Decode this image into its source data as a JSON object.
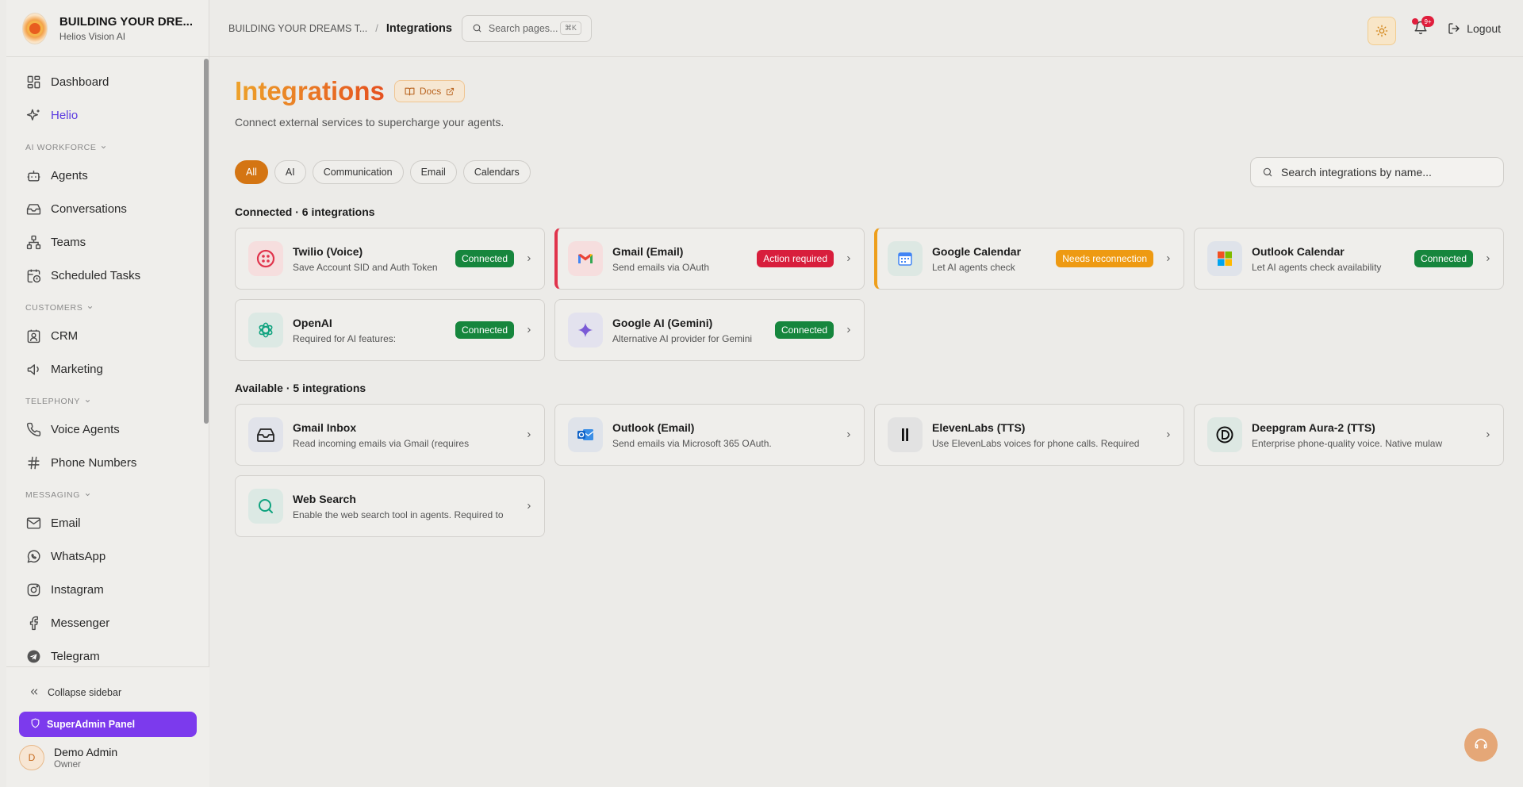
{
  "brand": {
    "title": "BUILDING YOUR DRE...",
    "subtitle": "Helios Vision AI"
  },
  "sidebar": {
    "top": [
      {
        "label": "Dashboard",
        "icon": "dashboard-icon"
      },
      {
        "label": "Helio",
        "icon": "sparkles-icon",
        "active": true
      }
    ],
    "sections": [
      {
        "title": "AI WORKFORCE",
        "items": [
          {
            "label": "Agents",
            "icon": "robot-icon"
          },
          {
            "label": "Conversations",
            "icon": "inbox-icon"
          },
          {
            "label": "Teams",
            "icon": "org-chart-icon"
          },
          {
            "label": "Scheduled Tasks",
            "icon": "calendar-clock-icon"
          }
        ]
      },
      {
        "title": "CUSTOMERS",
        "items": [
          {
            "label": "CRM",
            "icon": "contact-card-icon"
          },
          {
            "label": "Marketing",
            "icon": "megaphone-icon"
          }
        ]
      },
      {
        "title": "TELEPHONY",
        "items": [
          {
            "label": "Voice Agents",
            "icon": "phone-icon"
          },
          {
            "label": "Phone Numbers",
            "icon": "hash-icon"
          }
        ]
      },
      {
        "title": "MESSAGING",
        "items": [
          {
            "label": "Email",
            "icon": "mail-icon"
          },
          {
            "label": "WhatsApp",
            "icon": "whatsapp-icon"
          },
          {
            "label": "Instagram",
            "icon": "instagram-icon"
          },
          {
            "label": "Messenger",
            "icon": "facebook-icon"
          },
          {
            "label": "Telegram",
            "icon": "telegram-icon"
          }
        ]
      }
    ],
    "collapse_label": "Collapse sidebar",
    "superadmin_label": "SuperAdmin Panel",
    "user": {
      "initial": "D",
      "name": "Demo Admin",
      "role": "Owner"
    }
  },
  "topbar": {
    "crumb_parent": "BUILDING YOUR DREAMS T...",
    "crumb_sep": "/",
    "crumb_current": "Integrations",
    "search_placeholder": "Search pages...",
    "search_shortcut": "⌘K",
    "notification_count": "9+",
    "logout_label": "Logout"
  },
  "page": {
    "title": "Integrations",
    "docs_label": "Docs",
    "subtitle": "Connect external services to supercharge your agents.",
    "filters": [
      "All",
      "AI",
      "Communication",
      "Email",
      "Calendars"
    ],
    "active_filter": "All",
    "search_placeholder": "Search integrations by name..."
  },
  "connected": {
    "title": "Connected · 6 integrations",
    "cards": [
      {
        "name": "Twilio (Voice)",
        "desc": "Save Account SID and Auth Token",
        "status": "Connected",
        "status_color": "green",
        "icon": "twilio-icon",
        "icon_bg": "#f6dede",
        "accent": ""
      },
      {
        "name": "Gmail (Email)",
        "desc": "Send emails via OAuth",
        "status": "Action required",
        "status_color": "red",
        "icon": "gmail-icon",
        "icon_bg": "#f6dede",
        "accent": "red"
      },
      {
        "name": "Google Calendar",
        "desc": "Let AI agents check",
        "status": "Needs reconnection",
        "status_color": "orange",
        "icon": "google-calendar-icon",
        "icon_bg": "#dde8e3",
        "accent": "orange"
      },
      {
        "name": "Outlook Calendar",
        "desc": "Let AI agents check availability",
        "status": "Connected",
        "status_color": "green",
        "icon": "microsoft-icon",
        "icon_bg": "#dfe3ea",
        "accent": ""
      },
      {
        "name": "OpenAI",
        "desc": "Required for AI features:",
        "status": "Connected",
        "status_color": "green",
        "icon": "openai-icon",
        "icon_bg": "#dce9e4",
        "accent": ""
      },
      {
        "name": "Google AI (Gemini)",
        "desc": "Alternative AI provider for Gemini",
        "status": "Connected",
        "status_color": "green",
        "icon": "gemini-icon",
        "icon_bg": "#e3e2ee",
        "accent": ""
      }
    ]
  },
  "available": {
    "title": "Available · 5 integrations",
    "cards": [
      {
        "name": "Gmail Inbox",
        "desc": "Read incoming emails via Gmail (requires",
        "icon": "inbox-tray-icon",
        "icon_bg": "#e1e3ea"
      },
      {
        "name": "Outlook (Email)",
        "desc": "Send emails via Microsoft 365 OAuth.",
        "icon": "outlook-icon",
        "icon_bg": "#dfe3ea"
      },
      {
        "name": "ElevenLabs (TTS)",
        "desc": "Use ElevenLabs voices for phone calls. Required",
        "icon": "elevenlabs-icon",
        "icon_bg": "#e2e2e2"
      },
      {
        "name": "Deepgram Aura-2 (TTS)",
        "desc": "Enterprise phone-quality voice. Native mulaw",
        "icon": "deepgram-icon",
        "icon_bg": "#dde8e3"
      },
      {
        "name": "Web Search",
        "desc": "Enable the web search tool in agents. Required to",
        "icon": "search-icon",
        "icon_bg": "#dce9e4"
      }
    ]
  },
  "colors": {
    "accent": "#d47513",
    "superadmin": "#7c3aed",
    "connected": "#16863d",
    "action_required": "#d81e3c",
    "needs_reconnection": "#ee9a12"
  }
}
